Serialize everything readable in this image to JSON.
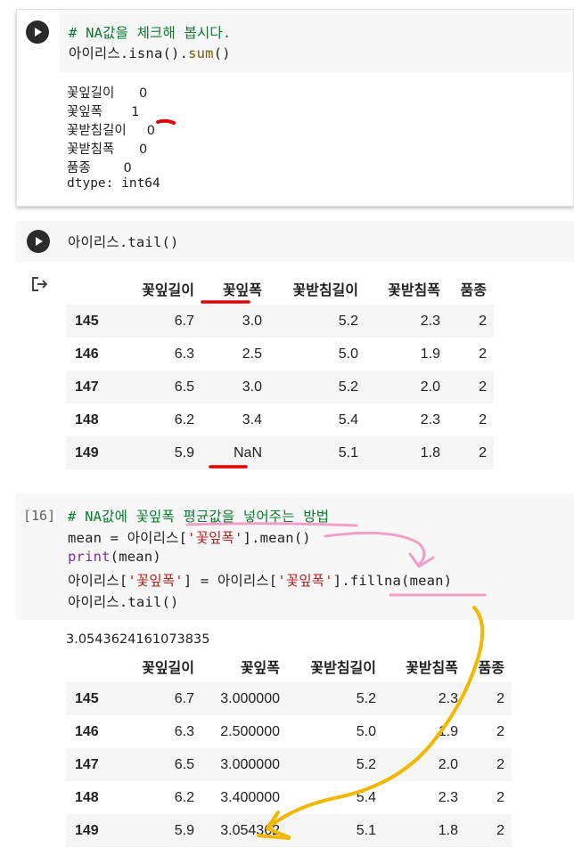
{
  "cell1": {
    "code_comment": "# NA값을 체크해 봅시다.",
    "code_var": "아이리스.isna().",
    "code_fn": "sum",
    "code_tail": "()",
    "output_lines": [
      "꽃잎길이      0",
      "꽃잎폭       1",
      "꽃받침길이     0",
      "꽃받침폭      0",
      "품종        0",
      "dtype: int64"
    ]
  },
  "cell2": {
    "code": "아이리스.tail()",
    "table": {
      "headers": [
        "",
        "꽃잎길이",
        "꽃잎폭",
        "꽃받침길이",
        "꽃받침폭",
        "품종"
      ],
      "rows": [
        [
          "145",
          "6.7",
          "3.0",
          "5.2",
          "2.3",
          "2"
        ],
        [
          "146",
          "6.3",
          "2.5",
          "5.0",
          "1.9",
          "2"
        ],
        [
          "147",
          "6.5",
          "3.0",
          "5.2",
          "2.0",
          "2"
        ],
        [
          "148",
          "6.2",
          "3.4",
          "5.4",
          "2.3",
          "2"
        ],
        [
          "149",
          "5.9",
          "NaN",
          "5.1",
          "1.8",
          "2"
        ]
      ]
    }
  },
  "cell3": {
    "exec_count": "[16]",
    "line1": "# NA값에 꽃잎폭 평균값을 넣어주는 방법",
    "line2_a": "mean = 아이리스[",
    "line2_str": "'꽃잎폭'",
    "line2_b": "].mean()",
    "line3_kw": "print",
    "line3_b": "(mean)",
    "line4_a": "아이리스[",
    "line4_str1": "'꽃잎폭'",
    "line4_b": "] = 아이리스[",
    "line4_str2": "'꽃잎폭'",
    "line4_c": "].fillna(mean)",
    "line5": "아이리스.tail()",
    "print_output": "3.0543624161073835",
    "table": {
      "headers": [
        "",
        "꽃잎길이",
        "꽃잎폭",
        "꽃받침길이",
        "꽃받침폭",
        "품종"
      ],
      "rows": [
        [
          "145",
          "6.7",
          "3.000000",
          "5.2",
          "2.3",
          "2"
        ],
        [
          "146",
          "6.3",
          "2.500000",
          "5.0",
          "1.9",
          "2"
        ],
        [
          "147",
          "6.5",
          "3.000000",
          "5.2",
          "2.0",
          "2"
        ],
        [
          "148",
          "6.2",
          "3.400000",
          "5.4",
          "2.3",
          "2"
        ],
        [
          "149",
          "5.9",
          "3.054362",
          "5.1",
          "1.8",
          "2"
        ]
      ]
    }
  },
  "colors": {
    "annotation_red": "#e00000",
    "annotation_pink": "#f0a0c8",
    "annotation_yellow": "#f2b800"
  },
  "icons": {
    "run": "play-icon",
    "output": "output-arrow-icon"
  }
}
